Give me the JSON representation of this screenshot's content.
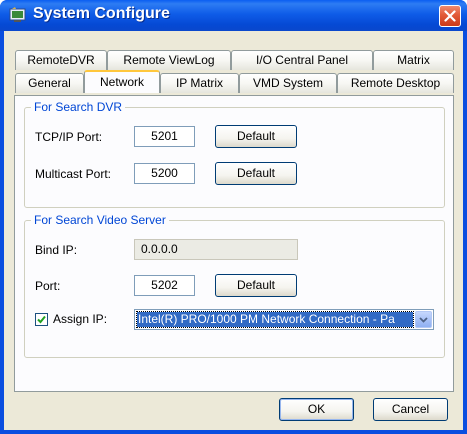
{
  "window": {
    "title": "System Configure"
  },
  "tabs": {
    "row_back": [
      {
        "label": "RemoteDVR"
      },
      {
        "label": "Remote ViewLog"
      },
      {
        "label": "I/O Central Panel"
      },
      {
        "label": "Matrix"
      }
    ],
    "row_front": [
      {
        "label": "General"
      },
      {
        "label": "Network"
      },
      {
        "label": "IP Matrix"
      },
      {
        "label": "VMD System"
      },
      {
        "label": "Remote Desktop"
      }
    ],
    "active": "Network"
  },
  "search_dvr": {
    "legend": "For Search DVR",
    "tcpip_label": "TCP/IP Port:",
    "tcpip_value": "5201",
    "tcpip_default": "Default",
    "multicast_label": "Multicast Port:",
    "multicast_value": "5200",
    "multicast_default": "Default"
  },
  "search_video_server": {
    "legend": "For Search Video Server",
    "bind_ip_label": "Bind IP:",
    "bind_ip_value": "0.0.0.0",
    "port_label": "Port:",
    "port_value": "5202",
    "port_default": "Default",
    "assign_ip_label": "Assign IP:",
    "assign_ip_checked": true,
    "assign_ip_selected": "Intel(R) PRO/1000 PM Network Connection - Pa"
  },
  "footer": {
    "ok": "OK",
    "cancel": "Cancel"
  },
  "colors": {
    "titlebar": "#0a5ef2",
    "legend_text": "#0046d5",
    "active_tab_highlight": "#ffc73c",
    "selection": "#316ac5"
  }
}
